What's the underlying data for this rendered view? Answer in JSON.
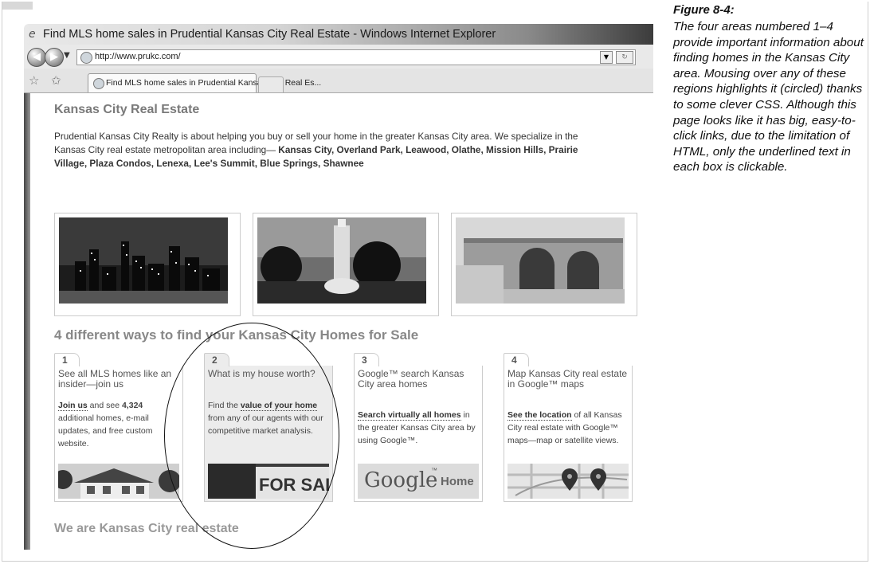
{
  "caption": {
    "title": "Figure 8-4:",
    "text": "The four areas numbered 1–4 provide important information about finding homes in the Kansas City area. Mousing over any of these regions highlights it (circled) thanks to some clever CSS. Although this page looks like it has big, easy-to-click links, due to the limitation of HTML, only the underlined text in each box is clickable."
  },
  "browser": {
    "window_title": "Find MLS home sales in Prudential Kansas City Real Estate - Windows Internet Explorer",
    "url": "http://www.prukc.com/",
    "tab_label": "Find MLS home sales in Prudential Kansas City Real Es...",
    "icons": [
      "ie-logo-icon",
      "back-icon",
      "forward-icon",
      "dropdown-icon",
      "refresh-icon",
      "favorites-star-icon",
      "add-favorites-icon",
      "page-icon"
    ]
  },
  "page": {
    "heading": "Kansas City Real Estate",
    "intro_plain": "Prudential Kansas City Realty is about helping you buy or sell your home in the greater Kansas City area. We specialize in the Kansas City real estate metropolitan area including—",
    "intro_bold": " Kansas City, Overland Park, Leawood, Olathe, Mission Hills, Prairie Village, Plaza Condos, Lenexa, Lee's Summit, Blue Springs, Shawnee",
    "section_heading": "4 different ways to find your Kansas City Homes for Sale",
    "footer_heading": "We are Kansas City real estate",
    "cards": [
      {
        "num": "1",
        "title": "See all MLS homes like an insider—join us",
        "link": "Join us",
        "pre": "",
        "mid": " and see ",
        "bold": "4,324",
        "post": " additional homes, e-mail updates, and free custom website."
      },
      {
        "num": "2",
        "title": "What is my house worth?",
        "pre": "Find the ",
        "link": "value of your home",
        "post": " from any of our agents with our competitive market analysis.",
        "sign": "FOR SALE"
      },
      {
        "num": "3",
        "title": "Google™ search Kansas City area homes",
        "link": "Search virtually all homes",
        "post": " in the greater Kansas City area by using Google™.",
        "google": "Google",
        "home": "Home"
      },
      {
        "num": "4",
        "title": "Map Kansas City real estate in Google™ maps",
        "link": "See the location",
        "post": " of all Kansas City real estate with Google™ maps—map or satellite views."
      }
    ]
  }
}
